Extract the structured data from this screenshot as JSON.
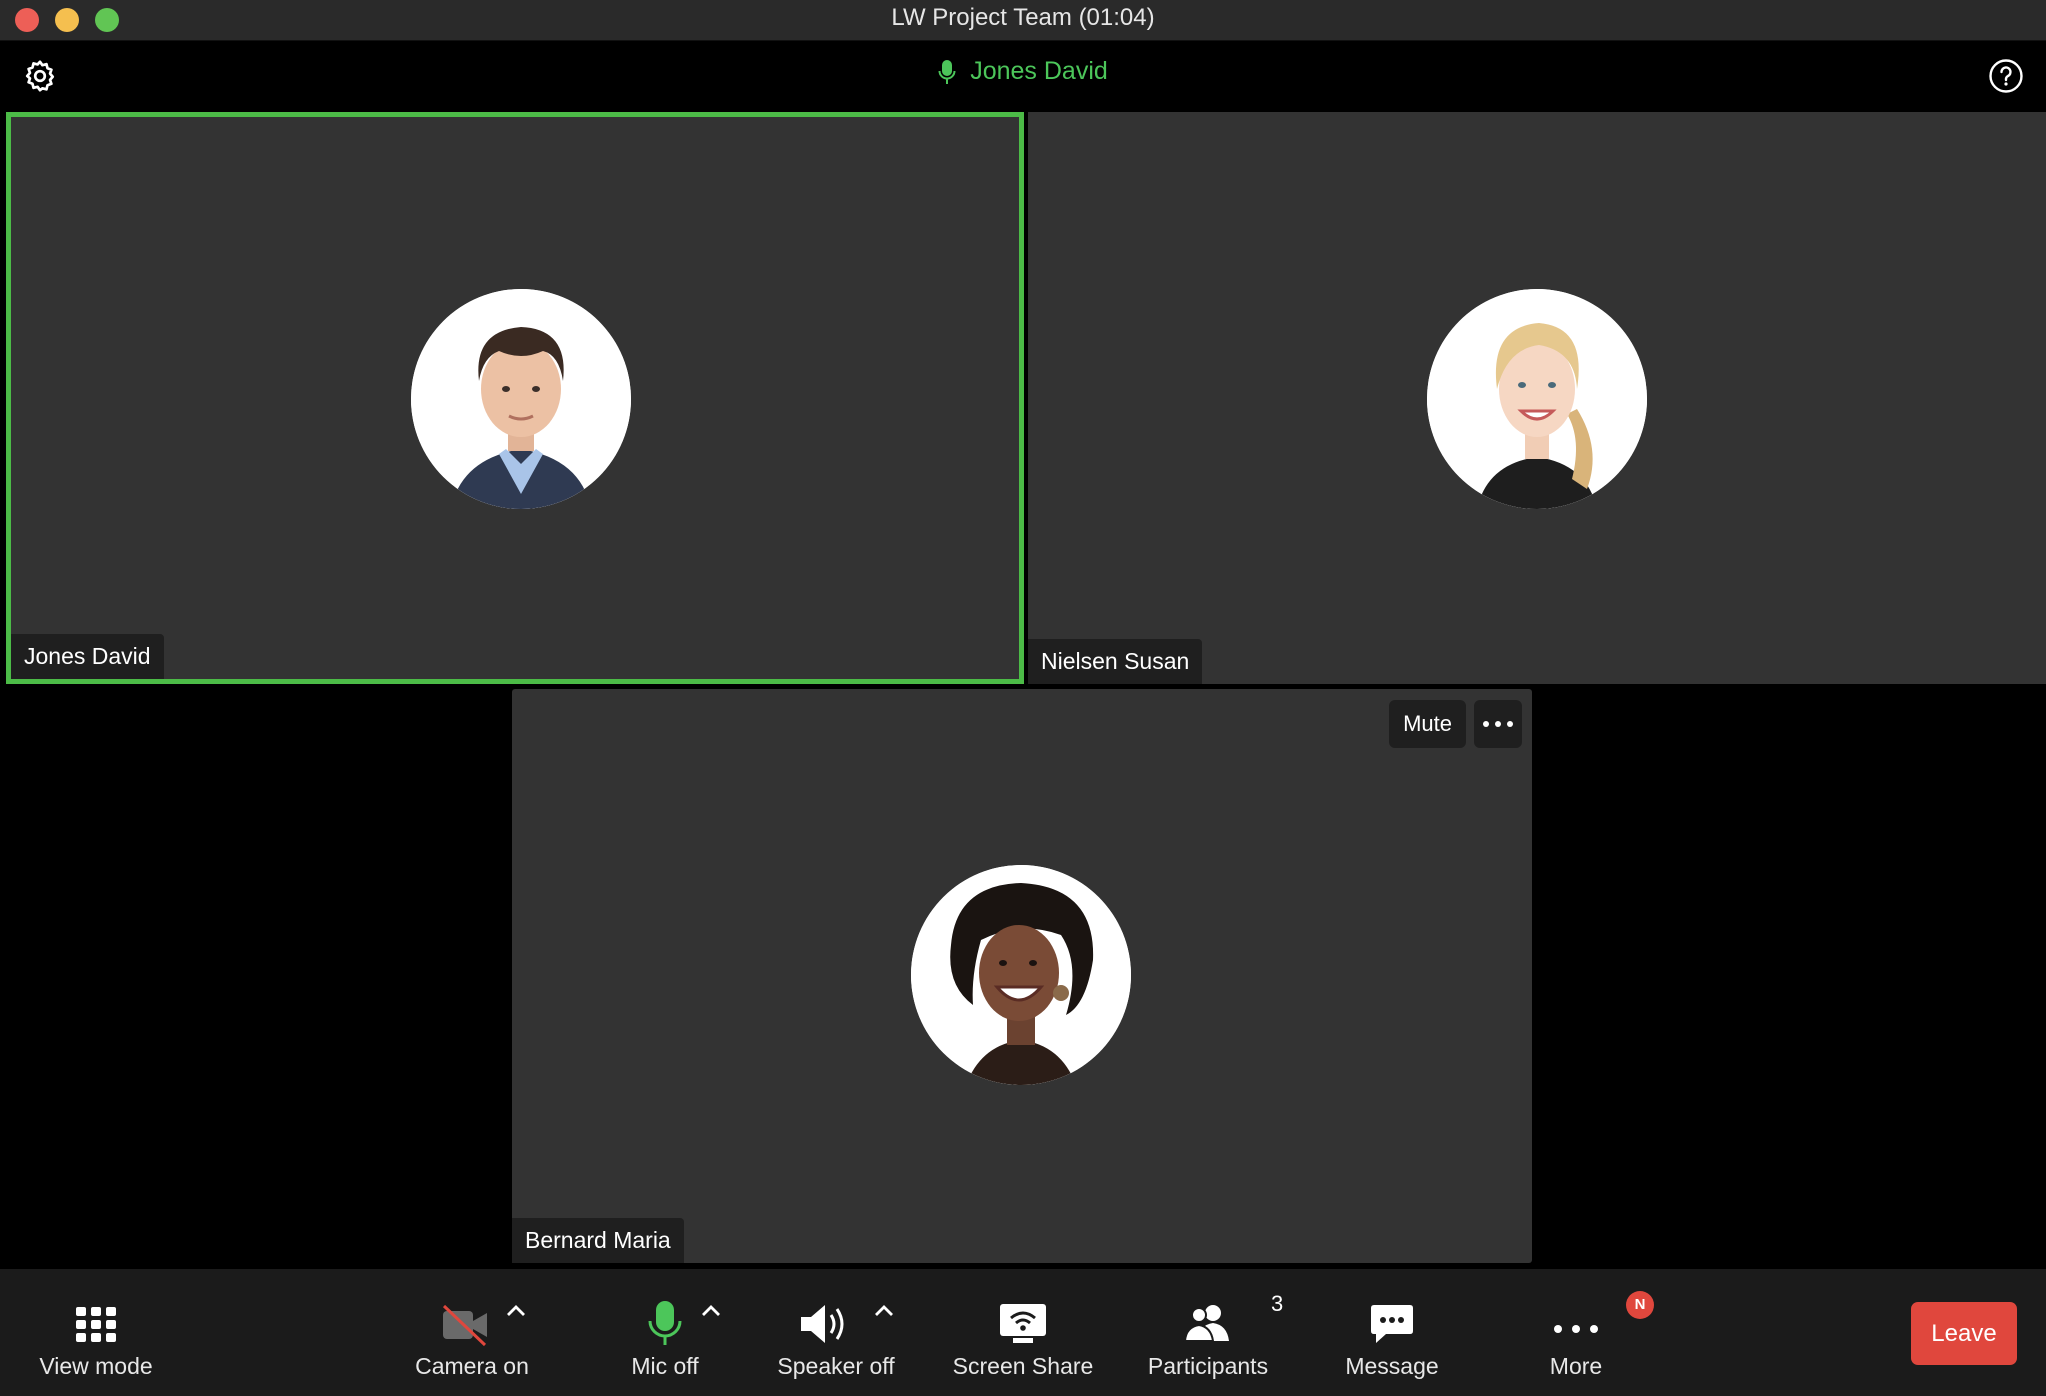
{
  "window": {
    "title": "LW Project Team (01:04)"
  },
  "topbar": {
    "active_speaker": "Jones David",
    "settings_icon": "gear-icon",
    "help_icon": "help-icon"
  },
  "participants": [
    {
      "name": "Jones David",
      "active_speaker": true,
      "avatar": "man-portrait"
    },
    {
      "name": "Nielsen Susan",
      "active_speaker": false,
      "avatar": "woman-portrait"
    },
    {
      "name": "Bernard Maria",
      "active_speaker": false,
      "avatar": "woman-portrait",
      "hover_controls": {
        "mute_label": "Mute",
        "more_icon": "ellipsis-icon"
      }
    }
  ],
  "toolbar": {
    "view_mode": "View mode",
    "camera": "Camera on",
    "mic": "Mic off",
    "speaker": "Speaker off",
    "screen_share": "Screen Share",
    "participants": "Participants",
    "participants_count": "3",
    "message": "Message",
    "more": "More",
    "more_badge": "N",
    "leave": "Leave"
  },
  "colors": {
    "active_border": "#4cbb47",
    "speaker_text": "#4cc65a",
    "leave_bg": "#e0473d",
    "tile_bg": "#333333"
  }
}
